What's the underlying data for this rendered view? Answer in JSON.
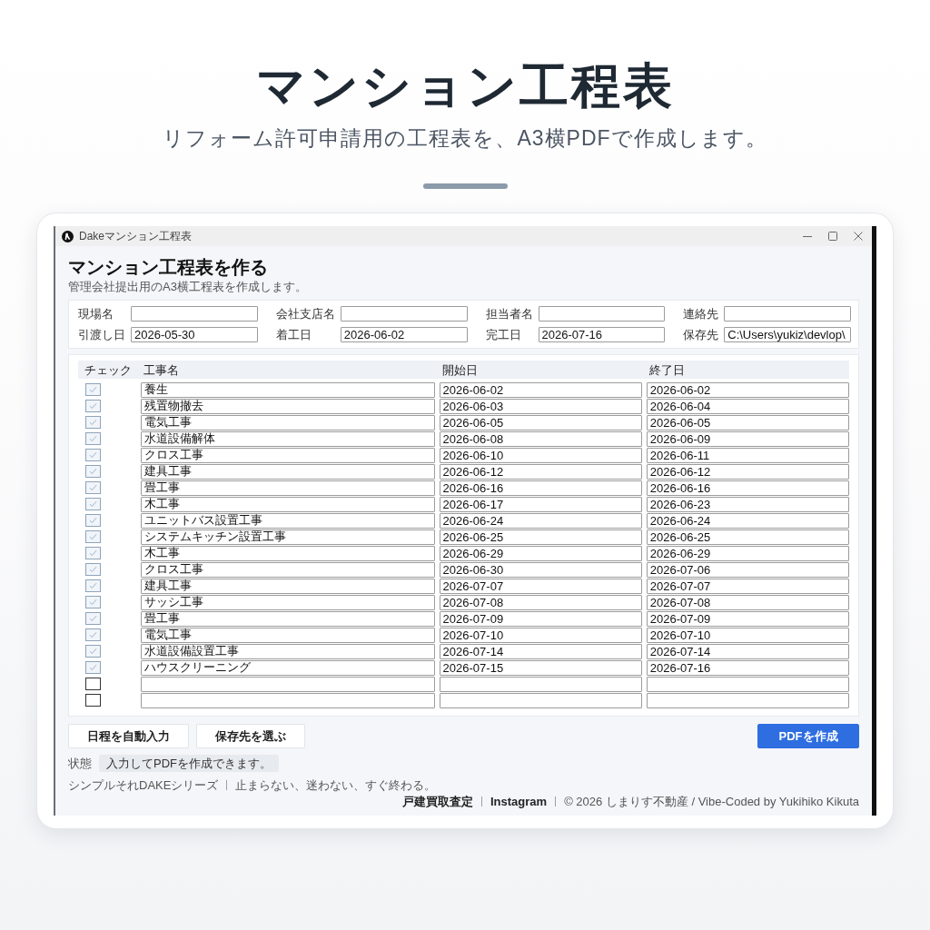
{
  "hero": {
    "title": "マンション工程表",
    "subtitle": "リフォーム許可申請用の工程表を、A3横PDFで作成します。"
  },
  "window": {
    "title": "Dakeマンション工程表"
  },
  "app": {
    "heading": "マンション工程表を作る",
    "description": "管理会社提出用のA3横工程表を作成します。"
  },
  "fields": [
    {
      "label": "現場名"
    },
    {
      "label": "会社支店名"
    },
    {
      "label": "担当者名"
    },
    {
      "label": "連絡先"
    },
    {
      "label": "引渡し日",
      "value": "2026-05-30"
    },
    {
      "label": "着工日",
      "value": "2026-06-02"
    },
    {
      "label": "完工日",
      "value": "2026-07-16"
    },
    {
      "label": "保存先",
      "value": "C:\\Users\\yukiz\\devlop\\"
    }
  ],
  "table": {
    "columns": [
      "チェック",
      "工事名",
      "開始日",
      "終了日"
    ],
    "rows": [
      {
        "checked": true,
        "name": "養生",
        "start": "2026-06-02",
        "end": "2026-06-02"
      },
      {
        "checked": true,
        "name": "残置物撤去",
        "start": "2026-06-03",
        "end": "2026-06-04"
      },
      {
        "checked": true,
        "name": "電気工事",
        "start": "2026-06-05",
        "end": "2026-06-05"
      },
      {
        "checked": true,
        "name": "水道設備解体",
        "start": "2026-06-08",
        "end": "2026-06-09"
      },
      {
        "checked": true,
        "name": "クロス工事",
        "start": "2026-06-10",
        "end": "2026-06-11"
      },
      {
        "checked": true,
        "name": "建具工事",
        "start": "2026-06-12",
        "end": "2026-06-12"
      },
      {
        "checked": true,
        "name": "畳工事",
        "start": "2026-06-16",
        "end": "2026-06-16"
      },
      {
        "checked": true,
        "name": "木工事",
        "start": "2026-06-17",
        "end": "2026-06-23"
      },
      {
        "checked": true,
        "name": "ユニットバス設置工事",
        "start": "2026-06-24",
        "end": "2026-06-24"
      },
      {
        "checked": true,
        "name": "システムキッチン設置工事",
        "start": "2026-06-25",
        "end": "2026-06-25"
      },
      {
        "checked": true,
        "name": "木工事",
        "start": "2026-06-29",
        "end": "2026-06-29"
      },
      {
        "checked": true,
        "name": "クロス工事",
        "start": "2026-06-30",
        "end": "2026-07-06"
      },
      {
        "checked": true,
        "name": "建具工事",
        "start": "2026-07-07",
        "end": "2026-07-07"
      },
      {
        "checked": true,
        "name": "サッシ工事",
        "start": "2026-07-08",
        "end": "2026-07-08"
      },
      {
        "checked": true,
        "name": "畳工事",
        "start": "2026-07-09",
        "end": "2026-07-09"
      },
      {
        "checked": true,
        "name": "電気工事",
        "start": "2026-07-10",
        "end": "2026-07-10"
      },
      {
        "checked": true,
        "name": "水道設備設置工事",
        "start": "2026-07-14",
        "end": "2026-07-14"
      },
      {
        "checked": true,
        "name": "ハウスクリーニング",
        "start": "2026-07-15",
        "end": "2026-07-16"
      },
      {
        "checked": false
      },
      {
        "checked": false
      }
    ]
  },
  "buttons": [
    {
      "label": "日程を自動入力",
      "kind": "secondary"
    },
    {
      "label": "保存先を選ぶ",
      "kind": "secondary"
    },
    {
      "label": "PDFを作成",
      "kind": "primary"
    }
  ],
  "status": {
    "label": "状態",
    "message": "入力してPDFを作成できます。"
  },
  "footer": {
    "left": [
      {
        "text": "シンプルそれDAKEシリーズ",
        "kind": "text"
      },
      {
        "text": "止まらない、迷わない、すぐ終わる。",
        "kind": "text"
      }
    ],
    "right": [
      {
        "text": "戸建買取査定",
        "kind": "link"
      },
      {
        "text": "Instagram",
        "kind": "link"
      },
      {
        "text": "© 2026 しまりす不動産 / Vibe-Coded by Yukihiko Kikuta",
        "kind": "text"
      }
    ]
  }
}
